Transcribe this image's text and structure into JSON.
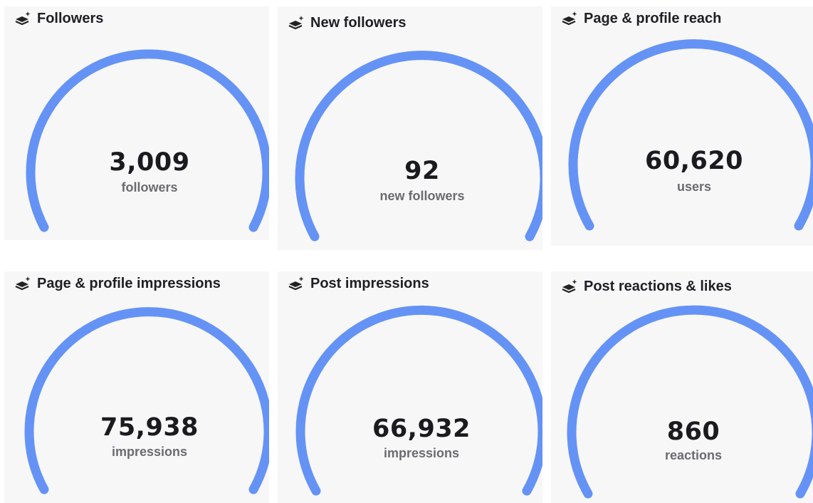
{
  "theme": {
    "gauge_color": "#6593f5",
    "card_background": "#f7f7f8",
    "title_color": "#1f1f24",
    "value_color": "#1b1b1f",
    "unit_color": "#6b6b70"
  },
  "cards": [
    {
      "icon": "layers-sparkle-icon",
      "title": "Followers",
      "value": "3,009",
      "unit": "followers"
    },
    {
      "icon": "layers-sparkle-icon",
      "title": "New followers",
      "value": "92",
      "unit": "new followers"
    },
    {
      "icon": "layers-sparkle-icon",
      "title": "Page & profile reach",
      "value": "60,620",
      "unit": "users"
    },
    {
      "icon": "layers-sparkle-icon",
      "title": "Page & profile impressions",
      "value": "75,938",
      "unit": "impressions"
    },
    {
      "icon": "layers-sparkle-icon",
      "title": "Post impressions",
      "value": "66,932",
      "unit": "impressions"
    },
    {
      "icon": "layers-sparkle-icon",
      "title": "Post reactions & likes",
      "value": "860",
      "unit": "reactions"
    }
  ]
}
